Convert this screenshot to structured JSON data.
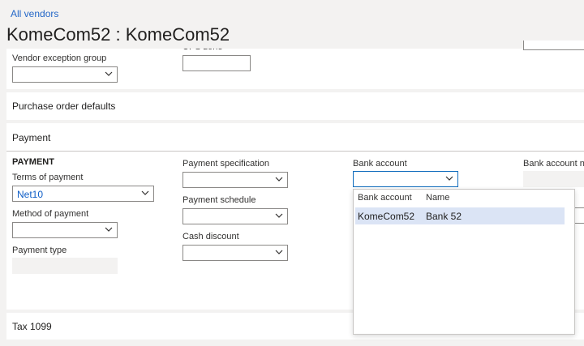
{
  "breadcrumb": "All vendors",
  "page_title": "KomeCom52 : KomeCom52",
  "top_section": {
    "vendor_exception_group_label": "Vendor exception group",
    "ups_zone_label": "UPS zone"
  },
  "purchase_order_defaults": {
    "title": "Purchase order defaults"
  },
  "payment": {
    "title": "Payment",
    "group_heading": "PAYMENT",
    "terms_of_payment_label": "Terms of payment",
    "terms_of_payment_value": "Net10",
    "method_of_payment_label": "Method of payment",
    "payment_type_label": "Payment type",
    "payment_specification_label": "Payment specification",
    "payment_schedule_label": "Payment schedule",
    "cash_discount_label": "Cash discount",
    "bank_account_label": "Bank account",
    "bank_account_n_label": "Bank account n"
  },
  "bank_account_dropdown": {
    "columns": [
      "Bank account",
      "Name"
    ],
    "rows": [
      {
        "bank_account": "KomeCom52",
        "name": "Bank 52"
      }
    ]
  },
  "tax_1099": {
    "title": "Tax 1099"
  }
}
